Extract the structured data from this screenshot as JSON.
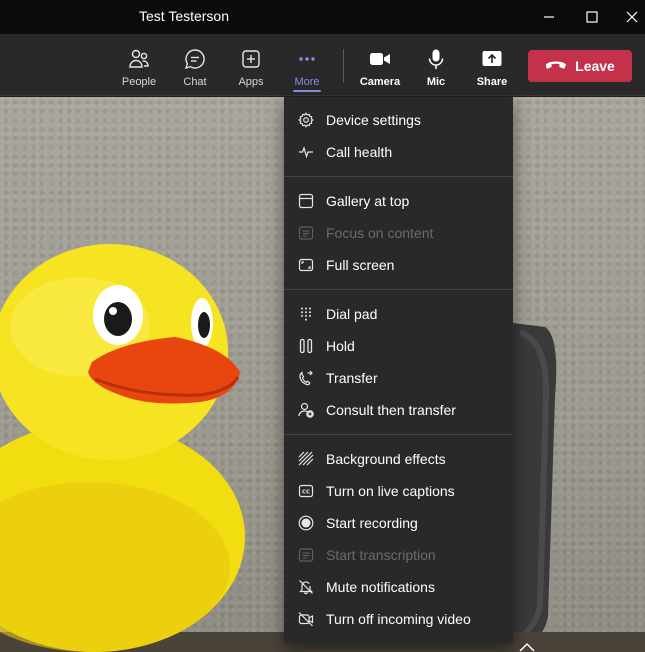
{
  "window": {
    "title": "Test Testerson",
    "controls": [
      "minimize",
      "maximize",
      "close"
    ]
  },
  "toolbar": {
    "buttons": [
      {
        "id": "people",
        "label": "People",
        "icon": "people-icon"
      },
      {
        "id": "chat",
        "label": "Chat",
        "icon": "chat-icon"
      },
      {
        "id": "apps",
        "label": "Apps",
        "icon": "apps-icon"
      },
      {
        "id": "more",
        "label": "More",
        "icon": "more-icon",
        "active": true
      },
      {
        "id": "camera",
        "label": "Camera",
        "icon": "camera-icon"
      },
      {
        "id": "mic",
        "label": "Mic",
        "icon": "mic-icon"
      },
      {
        "id": "share",
        "label": "Share",
        "icon": "share-icon"
      }
    ],
    "leave_label": "Leave"
  },
  "menu": {
    "groups": [
      [
        {
          "label": "Device settings",
          "icon": "gear-icon",
          "enabled": true
        },
        {
          "label": "Call health",
          "icon": "pulse-icon",
          "enabled": true
        }
      ],
      [
        {
          "label": "Gallery at top",
          "icon": "gallery-icon",
          "enabled": true
        },
        {
          "label": "Focus on content",
          "icon": "focus-icon",
          "enabled": false
        },
        {
          "label": "Full screen",
          "icon": "fullscreen-icon",
          "enabled": true
        }
      ],
      [
        {
          "label": "Dial pad",
          "icon": "dialpad-icon",
          "enabled": true
        },
        {
          "label": "Hold",
          "icon": "hold-icon",
          "enabled": true
        },
        {
          "label": "Transfer",
          "icon": "transfer-icon",
          "enabled": true
        },
        {
          "label": "Consult then transfer",
          "icon": "consult-transfer-icon",
          "enabled": true
        }
      ],
      [
        {
          "label": "Background effects",
          "icon": "background-effects-icon",
          "enabled": true
        },
        {
          "label": "Turn on live captions",
          "icon": "captions-icon",
          "enabled": true
        },
        {
          "label": "Start recording",
          "icon": "record-icon",
          "enabled": true
        },
        {
          "label": "Start transcription",
          "icon": "transcription-icon",
          "enabled": false
        },
        {
          "label": "Mute notifications",
          "icon": "bell-off-icon",
          "enabled": true
        },
        {
          "label": "Turn off incoming video",
          "icon": "video-off-icon",
          "enabled": true
        }
      ]
    ]
  },
  "colors": {
    "accent": "#8b8fe8",
    "leave": "#c4314b",
    "menu_bg": "#292929",
    "toolbar_bg": "#292929",
    "titlebar_bg": "#0b0b0b"
  }
}
